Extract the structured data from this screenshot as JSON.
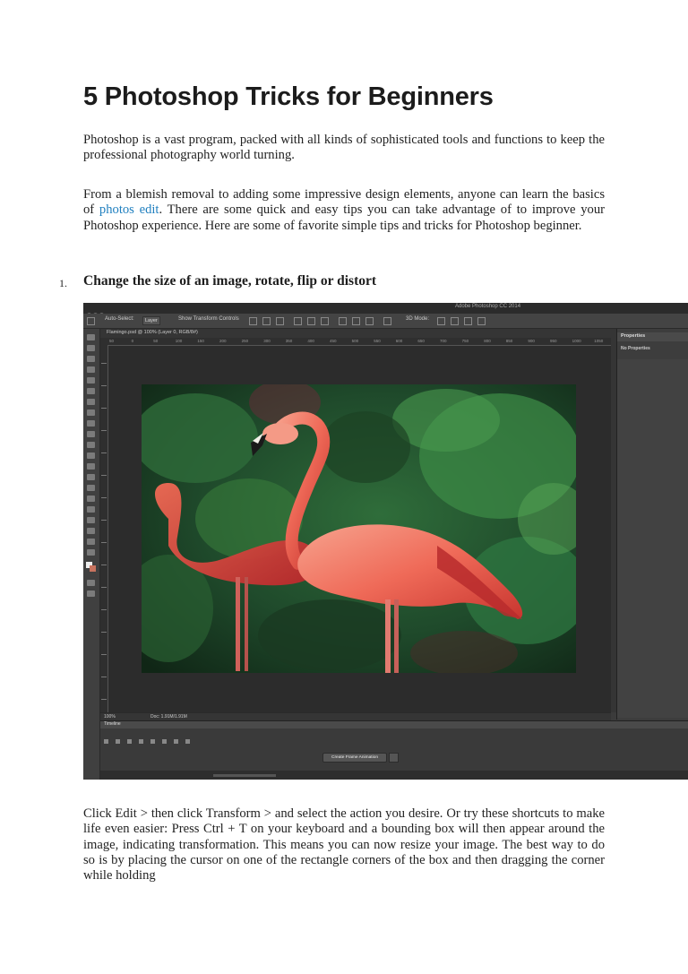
{
  "title": "5 Photoshop Tricks for Beginners",
  "intro": "Photoshop is a vast program, packed with all kinds of sophisticated tools and functions to keep the professional photography world turning.",
  "para2": {
    "before_link": "From a blemish removal to adding some impressive design elements, anyone can learn the basics of ",
    "link_text": "photos edit",
    "after_link": ". There are some quick and easy tips you can take advantage of to improve your Photoshop experience. Here are some of favorite simple tips and tricks for Photoshop beginner."
  },
  "list_item": {
    "number": "1.",
    "heading": "Change the size of an image, rotate, flip or distort"
  },
  "screenshot": {
    "app_title": "Adobe Photoshop CC 2014",
    "auto_select_label": "Auto-Select:",
    "auto_select_value": "Layer",
    "show_transform_label": "Show Transform Controls",
    "mode_3d": "3D Mode:",
    "doc_tab": "Flamingo.psd @ 100% (Layer 0, RGB/8#)",
    "ruler_ticks": [
      "50",
      "0",
      "50",
      "100",
      "150",
      "200",
      "250",
      "300",
      "350",
      "400",
      "450",
      "500",
      "550",
      "600",
      "650",
      "700",
      "750",
      "800",
      "850",
      "900",
      "950",
      "1000",
      "1050"
    ],
    "zoom": "100%",
    "doc_size": "Doc: 1.91M/1.91M",
    "panel_title": "Properties",
    "panel_sub": "No Properties",
    "timeline_label": "Timeline",
    "create_frame_button": "Create Frame Animation"
  },
  "para3": "Click Edit > then click Transform > and select the action you desire. Or try these shortcuts to make life even easier: Press Ctrl + T on your keyboard and a bounding box will then appear around the image, indicating transformation. This means you can now resize your image. The best way to do so is by placing the cursor on one of the rectangle corners of the box and then dragging the corner while holding",
  "colors": {
    "link": "#1f7fbf",
    "ps_background": "#3b3b3b"
  }
}
